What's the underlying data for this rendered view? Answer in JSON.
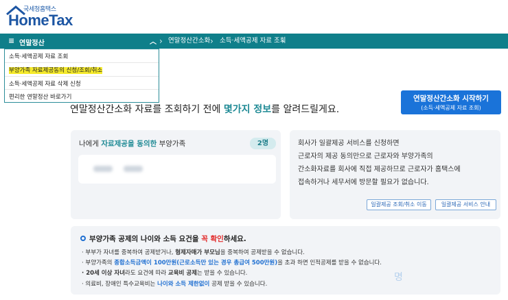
{
  "logo": {
    "small_text": "국세청홈택스",
    "brand": "HomeTax"
  },
  "nav": {
    "menu_label": "연말정산",
    "breadcrumb": [
      "연말정산간소화",
      "소득·세액공제 자료 조회"
    ]
  },
  "dropdown": {
    "items": [
      "소득·세액공제 자료 조회",
      "부양가족 자료제공동의 신청/조회/취소",
      "소득·세액공제 자료 삭제 신청",
      "편리한 연말정산 바로가기"
    ]
  },
  "headline": {
    "pre": "연말정산간소화 자료를 조회하기 전에 ",
    "accent": "몇가지 정보",
    "post": "를 알려드릴게요."
  },
  "start_button": {
    "line1": "연말정산간소화 시작하기",
    "line2": "(소득·세액공제 자료 조회)"
  },
  "consent_card": {
    "title_pre": "나에게 ",
    "title_accent": "자료제공을 동의한",
    "title_post": " 부양가족",
    "count": "2명"
  },
  "info_card": {
    "lines": [
      "회사가 일괄제공 서비스를 신청하면",
      "근로자의 제공 동의만으로 근로자와 부양가족의",
      "간소화자료를 회사에 직접 제공하므로 근로자가 홈택스에",
      "접속하거나 세무서에 방문할 필요가 없습니다."
    ],
    "button1": "일괄제공 조회/취소 이동",
    "button2": "일괄제공 서비스 안내"
  },
  "notice": {
    "title_pre": "부양가족 공제의 나이와 소득 요건을 ",
    "title_red": "꼭 확인",
    "title_post": "하세요.",
    "line1": {
      "a": "· 부부가 자녀를 중복하여 공제받거나, ",
      "b": "형제자매가 부모님",
      "c": "을 중복하여 공제받을 수 없습니다."
    },
    "line2": {
      "a": "· 부양가족의 ",
      "b": "종합소득금액이 100만원(근로소득만 있는 경우 총급여 500만원)",
      "c": "을 초과 하면 인적공제를 받을 수 없습니다."
    },
    "line3": {
      "a": "· 20세 이상 자녀",
      "b": "라도 요건에 따라 ",
      "c": "교육비 공제",
      "d": "는 받을 수 있습니다."
    },
    "line4": {
      "a": "· 의료비, 장애인 특수교육비는 ",
      "b": "나이와 소득 제한없이",
      "c": " 공제 받을 수 있습니다."
    }
  },
  "colors": {
    "teal": "#0f7f8a",
    "accent_teal": "#1f8a95",
    "blue": "#1a73d9",
    "red": "#e22b2b",
    "highlight": "#f5ea2c"
  }
}
